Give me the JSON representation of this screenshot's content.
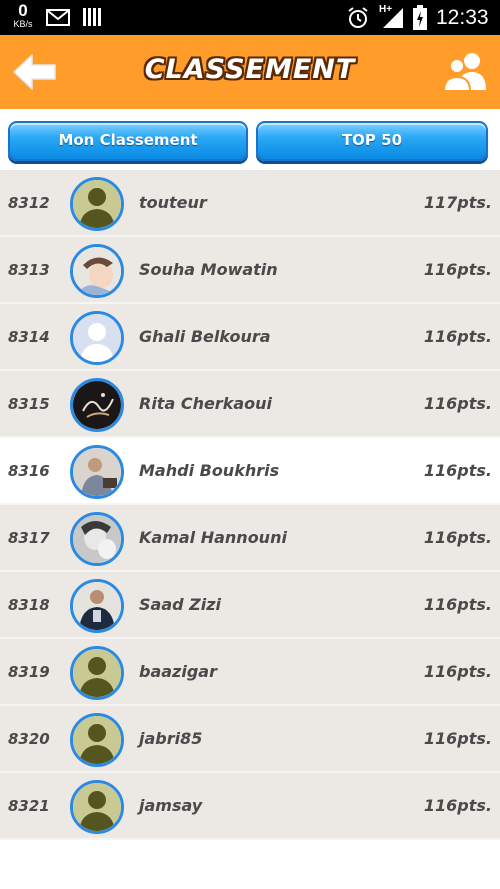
{
  "status_bar": {
    "speed_value": "0",
    "speed_unit": "KB/s",
    "network_type": "H+",
    "time": "12:33",
    "icons": [
      "mail-icon",
      "bars-icon",
      "alarm-icon",
      "signal-icon",
      "battery-icon"
    ]
  },
  "header": {
    "title": "CLASSEMENT",
    "back_icon": "arrow-left-icon",
    "friends_icon": "friends-icon",
    "bg_color": "#ff9c2a"
  },
  "tabs": {
    "my_ranking": "Mon Classement",
    "top50": "TOP 50",
    "color": "#1a8fe6"
  },
  "ranking": [
    {
      "rank": "8312",
      "name": "touteur",
      "points": "117pts.",
      "avatar": "default-olive",
      "current": false
    },
    {
      "rank": "8313",
      "name": "Souha Mowatin",
      "points": "116pts.",
      "avatar": "photo-child",
      "current": false
    },
    {
      "rank": "8314",
      "name": "Ghali Belkoura",
      "points": "116pts.",
      "avatar": "default-blue",
      "current": false
    },
    {
      "rank": "8315",
      "name": "Rita Cherkaoui",
      "points": "116pts.",
      "avatar": "photo-calligraphy",
      "current": false
    },
    {
      "rank": "8316",
      "name": "Mahdi Boukhris",
      "points": "116pts.",
      "avatar": "photo-person",
      "current": true
    },
    {
      "rank": "8317",
      "name": "Kamal Hannouni",
      "points": "116pts.",
      "avatar": "photo-grayscale",
      "current": false
    },
    {
      "rank": "8318",
      "name": "Saad Zizi",
      "points": "116pts.",
      "avatar": "photo-person-dark",
      "current": false
    },
    {
      "rank": "8319",
      "name": "baazigar",
      "points": "116pts.",
      "avatar": "default-olive",
      "current": false
    },
    {
      "rank": "8320",
      "name": "jabri85",
      "points": "116pts.",
      "avatar": "default-olive",
      "current": false
    },
    {
      "rank": "8321",
      "name": "jamsay",
      "points": "116pts.",
      "avatar": "default-olive",
      "current": false
    }
  ]
}
